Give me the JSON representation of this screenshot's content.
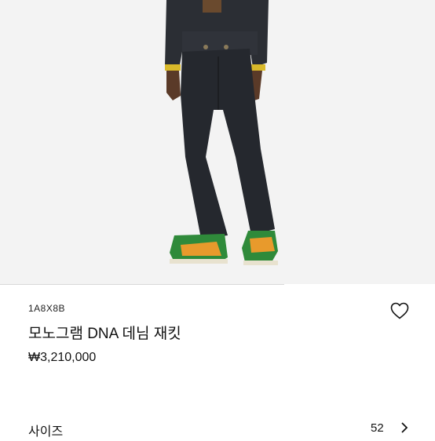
{
  "product": {
    "sku": "1A8X8B",
    "name": "모노그램 DNA 데님 재킷",
    "price": "₩3,210,000"
  },
  "size_selector": {
    "label": "사이즈",
    "value": "52"
  },
  "icons": {
    "wishlist": "heart-outline-icon",
    "size_chevron": "chevron-right-icon"
  },
  "colors": {
    "background": "#ffffff",
    "photo_background": "#f3f3f3",
    "denim": "#2a2d33",
    "sneaker_green": "#2f8a3a",
    "sneaker_orange": "#e89a2c"
  }
}
